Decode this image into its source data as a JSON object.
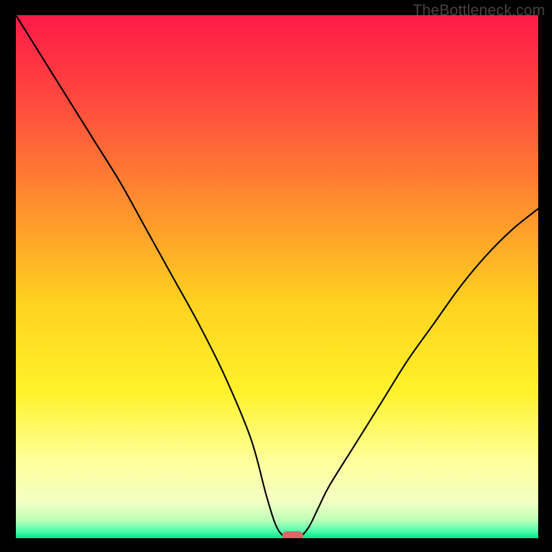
{
  "watermark": "TheBottleneck.com",
  "chart_data": {
    "type": "line",
    "title": "",
    "xlabel": "",
    "ylabel": "",
    "xlim": [
      0,
      100
    ],
    "ylim": [
      0,
      100
    ],
    "x": [
      0,
      5,
      10,
      15,
      20,
      25,
      30,
      35,
      40,
      45,
      48,
      50,
      52,
      54,
      56,
      58,
      60,
      65,
      70,
      75,
      80,
      85,
      90,
      95,
      100
    ],
    "values": [
      100,
      92,
      84,
      76,
      68,
      59,
      50,
      41,
      31,
      19,
      8,
      2,
      0,
      0,
      2,
      6,
      10,
      18,
      26,
      34,
      41,
      48,
      54,
      59,
      63
    ],
    "marker": {
      "x": 53,
      "y": 0
    },
    "background_gradient": {
      "stops": [
        {
          "offset": 0,
          "color": "#ff1a48"
        },
        {
          "offset": 0.17,
          "color": "#ff4b3e"
        },
        {
          "offset": 0.35,
          "color": "#ff8a2f"
        },
        {
          "offset": 0.55,
          "color": "#ffd21f"
        },
        {
          "offset": 0.72,
          "color": "#fff22a"
        },
        {
          "offset": 0.85,
          "color": "#ffff9a"
        },
        {
          "offset": 0.93,
          "color": "#f3ffc4"
        },
        {
          "offset": 0.965,
          "color": "#c0ffb8"
        },
        {
          "offset": 0.985,
          "color": "#57ffad"
        },
        {
          "offset": 1.0,
          "color": "#00e78a"
        }
      ]
    }
  }
}
